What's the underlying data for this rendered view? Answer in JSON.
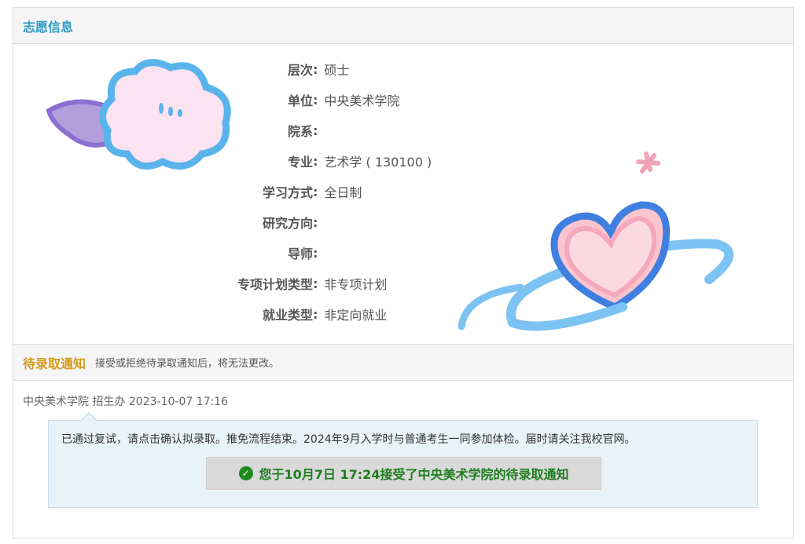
{
  "section_title": "志愿信息",
  "fields": [
    {
      "label": "层次",
      "value": "硕士"
    },
    {
      "label": "单位",
      "value": "中央美术学院"
    },
    {
      "label": "院系",
      "value": ""
    },
    {
      "label": "专业",
      "value": "艺术学 ( 130100 )"
    },
    {
      "label": "学习方式",
      "value": "全日制"
    },
    {
      "label": "研究方向",
      "value": ""
    },
    {
      "label": "导师",
      "value": ""
    },
    {
      "label": "专项计划类型",
      "value": "非专项计划"
    },
    {
      "label": "就业类型",
      "value": "非定向就业"
    }
  ],
  "colon": ":",
  "notice": {
    "title": "待录取通知",
    "note": "接受或拒绝待录取通知后，将无法更改。",
    "meta": "中央美术学院 招生办 2023-10-07 17:16",
    "message": "已通过复试，请点击确认拟录取。推免流程结束。2024年9月入学时与普通考生一同参加体检。届时请关注我校官网。",
    "accepted_icon": "check-circle-icon",
    "accepted_text": "您于10月7日 17:24接受了中央美术学院的待录取通知"
  }
}
